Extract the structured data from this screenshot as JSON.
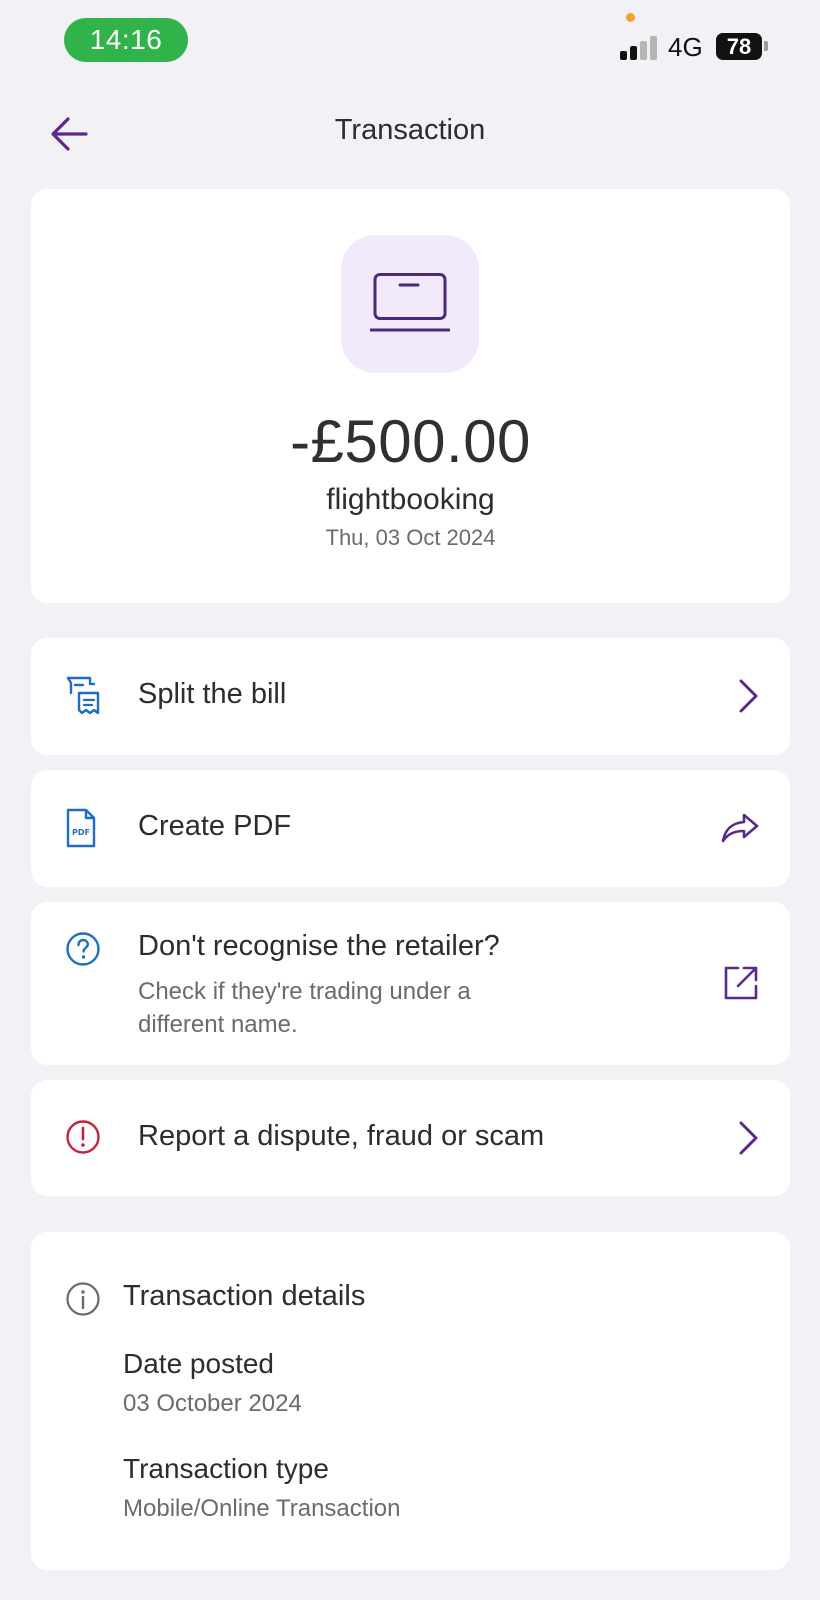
{
  "status_bar": {
    "time": "14:16",
    "network": "4G",
    "battery": "78",
    "colors": {
      "time_pill": "#2fb34a",
      "privacy_dot": "#f2a233"
    }
  },
  "nav": {
    "title": "Transaction",
    "back_icon": "arrow-left-icon"
  },
  "transaction": {
    "icon": "laptop-icon",
    "amount": "-£500.00",
    "merchant": "flightbooking",
    "date": "Thu, 03 Oct 2024"
  },
  "actions": [
    {
      "label": "Split the bill",
      "icon": "receipt-split-icon",
      "trail_icon": "chevron-right-icon"
    },
    {
      "label": "Create PDF",
      "icon": "pdf-file-icon",
      "trail_icon": "share-arrow-icon"
    },
    {
      "label": "Don't recognise the retailer?",
      "sublabel": "Check if they're trading under a different name.",
      "icon": "question-circle-icon",
      "trail_icon": "external-link-icon"
    },
    {
      "label": "Report a dispute, fraud or scam",
      "icon": "alert-circle-icon",
      "trail_icon": "chevron-right-icon"
    }
  ],
  "details": {
    "title": "Transaction details",
    "icon": "info-circle-icon",
    "date_posted_label": "Date posted",
    "date_posted_value": "03 October 2024",
    "type_label": "Transaction type",
    "type_value": "Mobile/Online Transaction"
  },
  "colors": {
    "accent_purple": "#5a2a8a",
    "icon_blue": "#1f6fc0",
    "alert_red": "#c8203a",
    "background": "#f1f1f6"
  }
}
